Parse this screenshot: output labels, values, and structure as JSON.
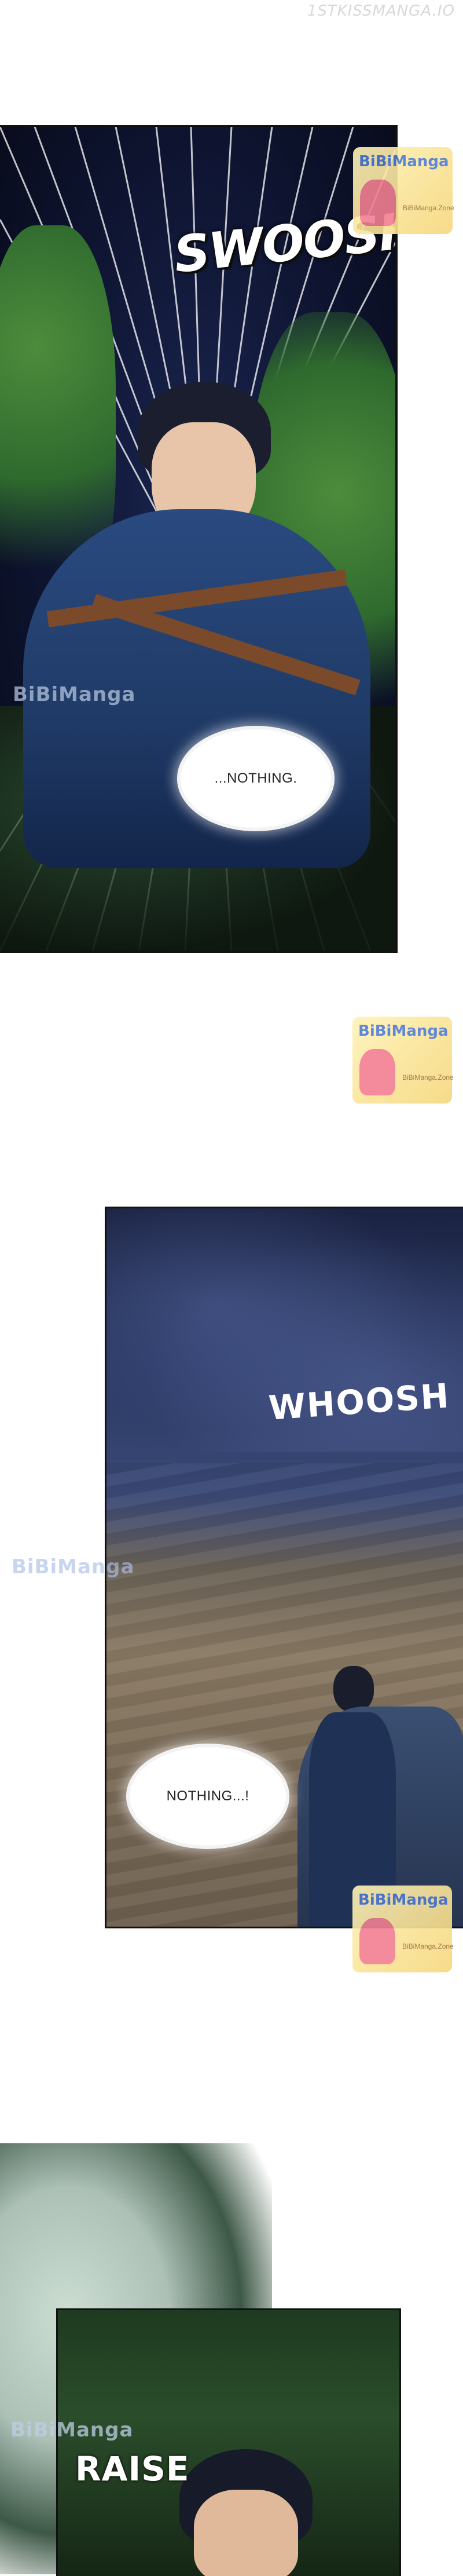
{
  "site_watermark": "1STKISSMANGA.IO",
  "side_watermark": "BiBiManga",
  "badge": {
    "title": "BiBiManga",
    "subtitle": "BiBiManga.Zone"
  },
  "panel1": {
    "sfx": "SWOOSH",
    "speech": "...NOTHING."
  },
  "panel2": {
    "sfx": "WHOOSH",
    "speech": "NOTHING...!"
  },
  "panel3": {
    "sfx": "RAISE"
  },
  "colors": {
    "night_blue": "#0e1430",
    "foliage": "#2f6a2e",
    "uniform": "#1f3a66",
    "badge_yellow": "#f6d77c"
  }
}
